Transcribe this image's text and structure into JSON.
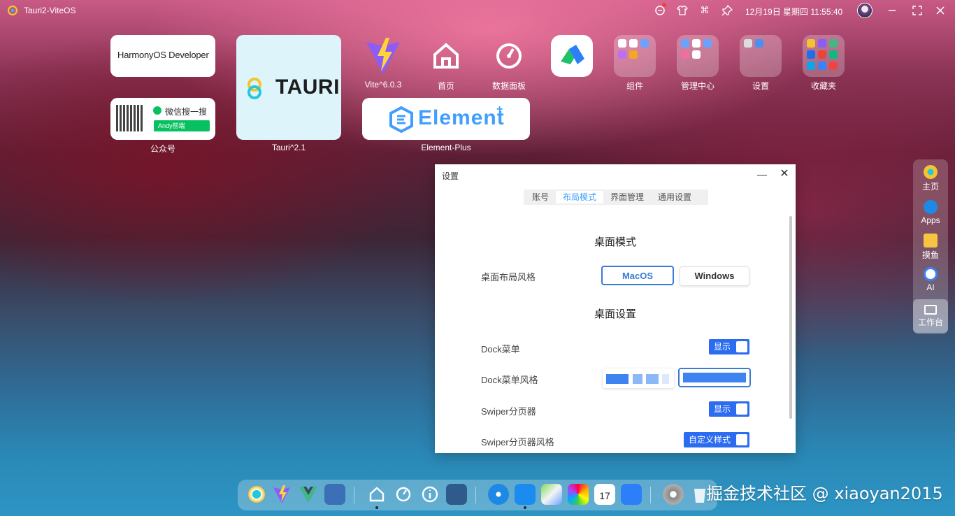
{
  "topbar": {
    "app_title": "Tauri2-ViteOS",
    "datetime": "12月19日 星期四 11:55:40",
    "icons": [
      "chat-icon",
      "shirt-icon",
      "command-icon",
      "pin-icon",
      "minimize-icon",
      "maximize-icon",
      "close-icon"
    ]
  },
  "desktop": {
    "harmony": {
      "text": "HarmonyOS Developer"
    },
    "wechat": {
      "search_text": "微信搜一搜",
      "bar_text": "Andy前端",
      "label": "公众号"
    },
    "tauri": {
      "word": "TAURI",
      "label": "Tauri^2.1"
    },
    "element": {
      "word": "Element",
      "plus": "+",
      "label": "Element-Plus"
    },
    "apps": [
      {
        "label": "Vite^6.0.3",
        "icon": "vite-icon"
      },
      {
        "label": "首页",
        "icon": "home-icon"
      },
      {
        "label": "数据面板",
        "icon": "dashboard-icon"
      },
      {
        "label": "",
        "icon": "app-logo-icon"
      },
      {
        "label": "组件",
        "icon": "folder-icon"
      },
      {
        "label": "管理中心",
        "icon": "folder-icon"
      },
      {
        "label": "设置",
        "icon": "folder-icon"
      },
      {
        "label": "收藏夹",
        "icon": "folder-icon"
      }
    ]
  },
  "right_sidebar": {
    "items": [
      {
        "label": "主页",
        "icon": "home-logo-icon"
      },
      {
        "label": "Apps",
        "icon": "compass-icon"
      },
      {
        "label": "摸鱼",
        "icon": "fish-icon"
      },
      {
        "label": "AI",
        "icon": "robot-icon"
      },
      {
        "label": "工作台",
        "icon": "monitor-icon"
      }
    ]
  },
  "settings_window": {
    "title": "设置",
    "minimize": "—",
    "close": "✕",
    "tabs": [
      "账号",
      "布局模式",
      "界面管理",
      "通用设置"
    ],
    "active_tab": "布局模式",
    "section1_title": "桌面模式",
    "layout_style_label": "桌面布局风格",
    "layout_options": [
      "MacOS",
      "Windows"
    ],
    "selected_layout": "MacOS",
    "section2_title": "桌面设置",
    "dock_menu_label": "Dock菜单",
    "dock_menu_toggle": "显示",
    "dock_style_label": "Dock菜单风格",
    "swiper_label": "Swiper分页器",
    "swiper_toggle": "显示",
    "swiper_style_label": "Swiper分页器风格",
    "swiper_style_toggle": "自定义样式",
    "accent": "#2b6cf0"
  },
  "dock": {
    "icons": [
      "tauri-icon",
      "vite-icon",
      "vue-icon",
      "apps-icon",
      "home-icon",
      "dashboard-icon",
      "info-icon",
      "grid-icon",
      "safari-icon",
      "appstore-icon",
      "maps-icon",
      "photos-icon",
      "calendar-icon",
      "widgets-icon",
      "settings-icon",
      "trash-icon"
    ],
    "calendar_day": "17"
  },
  "watermark": "掘金技术社区 @ xiaoyan2015"
}
